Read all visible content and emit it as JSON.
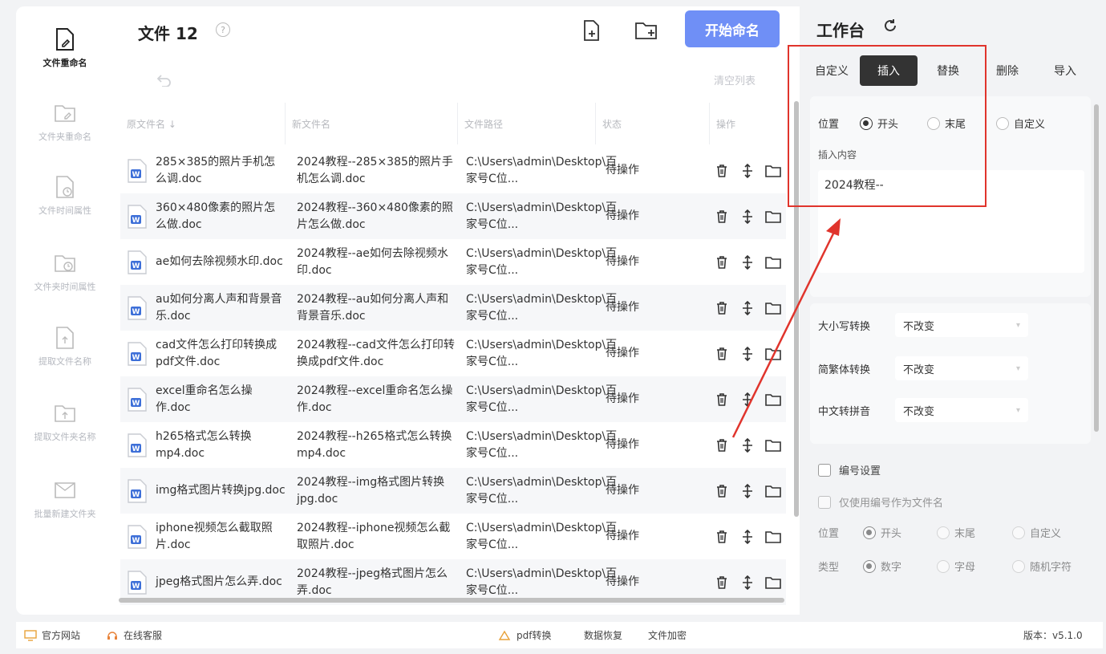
{
  "sidebar": {
    "items": [
      {
        "label": "文件重命名",
        "icon": "file-rename-icon",
        "active": true
      },
      {
        "label": "文件夹重命名",
        "icon": "folder-rename-icon"
      },
      {
        "label": "文件时间属性",
        "icon": "file-clock-icon"
      },
      {
        "label": "文件夹时间属性",
        "icon": "folder-clock-icon"
      },
      {
        "label": "提取文件名称",
        "icon": "file-extract-icon"
      },
      {
        "label": "提取文件夹名称",
        "icon": "folder-extract-icon"
      },
      {
        "label": "批量新建文件夹",
        "icon": "folder-create-icon"
      }
    ]
  },
  "main": {
    "title": "文件 12",
    "help": "?",
    "start_button": "开始命名",
    "clear_list": "清空列表",
    "columns": [
      "原文件名 ↓",
      "新文件名",
      "文件路径",
      "状态",
      "操作"
    ],
    "rows": [
      {
        "orig": "285×385的照片手机怎么调.doc",
        "new": "2024教程--285×385的照片手机怎么调.doc",
        "path": "C:\\Users\\admin\\Desktop\\百家号C位...",
        "status": "待操作"
      },
      {
        "orig": "360×480像素的照片怎么做.doc",
        "new": "2024教程--360×480像素的照片怎么做.doc",
        "path": "C:\\Users\\admin\\Desktop\\百家号C位...",
        "status": "待操作"
      },
      {
        "orig": "ae如何去除视频水印.doc",
        "new": "2024教程--ae如何去除视频水印.doc",
        "path": "C:\\Users\\admin\\Desktop\\百家号C位...",
        "status": "待操作"
      },
      {
        "orig": "au如何分离人声和背景音乐.doc",
        "new": "2024教程--au如何分离人声和背景音乐.doc",
        "path": "C:\\Users\\admin\\Desktop\\百家号C位...",
        "status": "待操作"
      },
      {
        "orig": "cad文件怎么打印转换成pdf文件.doc",
        "new": "2024教程--cad文件怎么打印转换成pdf文件.doc",
        "path": "C:\\Users\\admin\\Desktop\\百家号C位...",
        "status": "待操作"
      },
      {
        "orig": "excel重命名怎么操作.doc",
        "new": "2024教程--excel重命名怎么操作.doc",
        "path": "C:\\Users\\admin\\Desktop\\百家号C位...",
        "status": "待操作"
      },
      {
        "orig": "h265格式怎么转换mp4.doc",
        "new": "2024教程--h265格式怎么转换mp4.doc",
        "path": "C:\\Users\\admin\\Desktop\\百家号C位...",
        "status": "待操作"
      },
      {
        "orig": "img格式图片转换jpg.doc",
        "new": "2024教程--img格式图片转换jpg.doc",
        "path": "C:\\Users\\admin\\Desktop\\百家号C位...",
        "status": "待操作"
      },
      {
        "orig": "iphone视频怎么截取照片.doc",
        "new": "2024教程--iphone视频怎么截取照片.doc",
        "path": "C:\\Users\\admin\\Desktop\\百家号C位...",
        "status": "待操作"
      },
      {
        "orig": "jpeg格式图片怎么弄.doc",
        "new": "2024教程--jpeg格式图片怎么弄.doc",
        "path": "C:\\Users\\admin\\Desktop\\百家号C位...",
        "status": "待操作"
      }
    ]
  },
  "workbench": {
    "title": "工作台",
    "tabs": [
      "自定义",
      "插入",
      "替换",
      "删除",
      "导入"
    ],
    "active_tab": "插入",
    "position_label": "位置",
    "position_options": [
      "开头",
      "末尾",
      "自定义"
    ],
    "position_selected": "开头",
    "insert_label": "插入内容",
    "insert_value": "2024教程--",
    "case_label": "大小写转换",
    "case_value": "不改变",
    "trad_label": "简繁体转换",
    "trad_value": "不改变",
    "pinyin_label": "中文转拼音",
    "pinyin_value": "不改变",
    "numbering_label": "编号设置",
    "numbering_only_label": "仅使用编号作为文件名",
    "num_position_label": "位置",
    "num_position_options": [
      "开头",
      "末尾",
      "自定义"
    ],
    "num_type_label": "类型",
    "num_type_options": [
      "数字",
      "字母",
      "随机字符"
    ]
  },
  "bottom": {
    "website": "官方网站",
    "service": "在线客服",
    "links": [
      "pdf转换",
      "数据恢复",
      "文件加密"
    ],
    "version": "版本：v5.1.0"
  },
  "colors": {
    "accent": "#6f8ff6",
    "annotation": "#e0342c",
    "tab_active": "#333333"
  }
}
